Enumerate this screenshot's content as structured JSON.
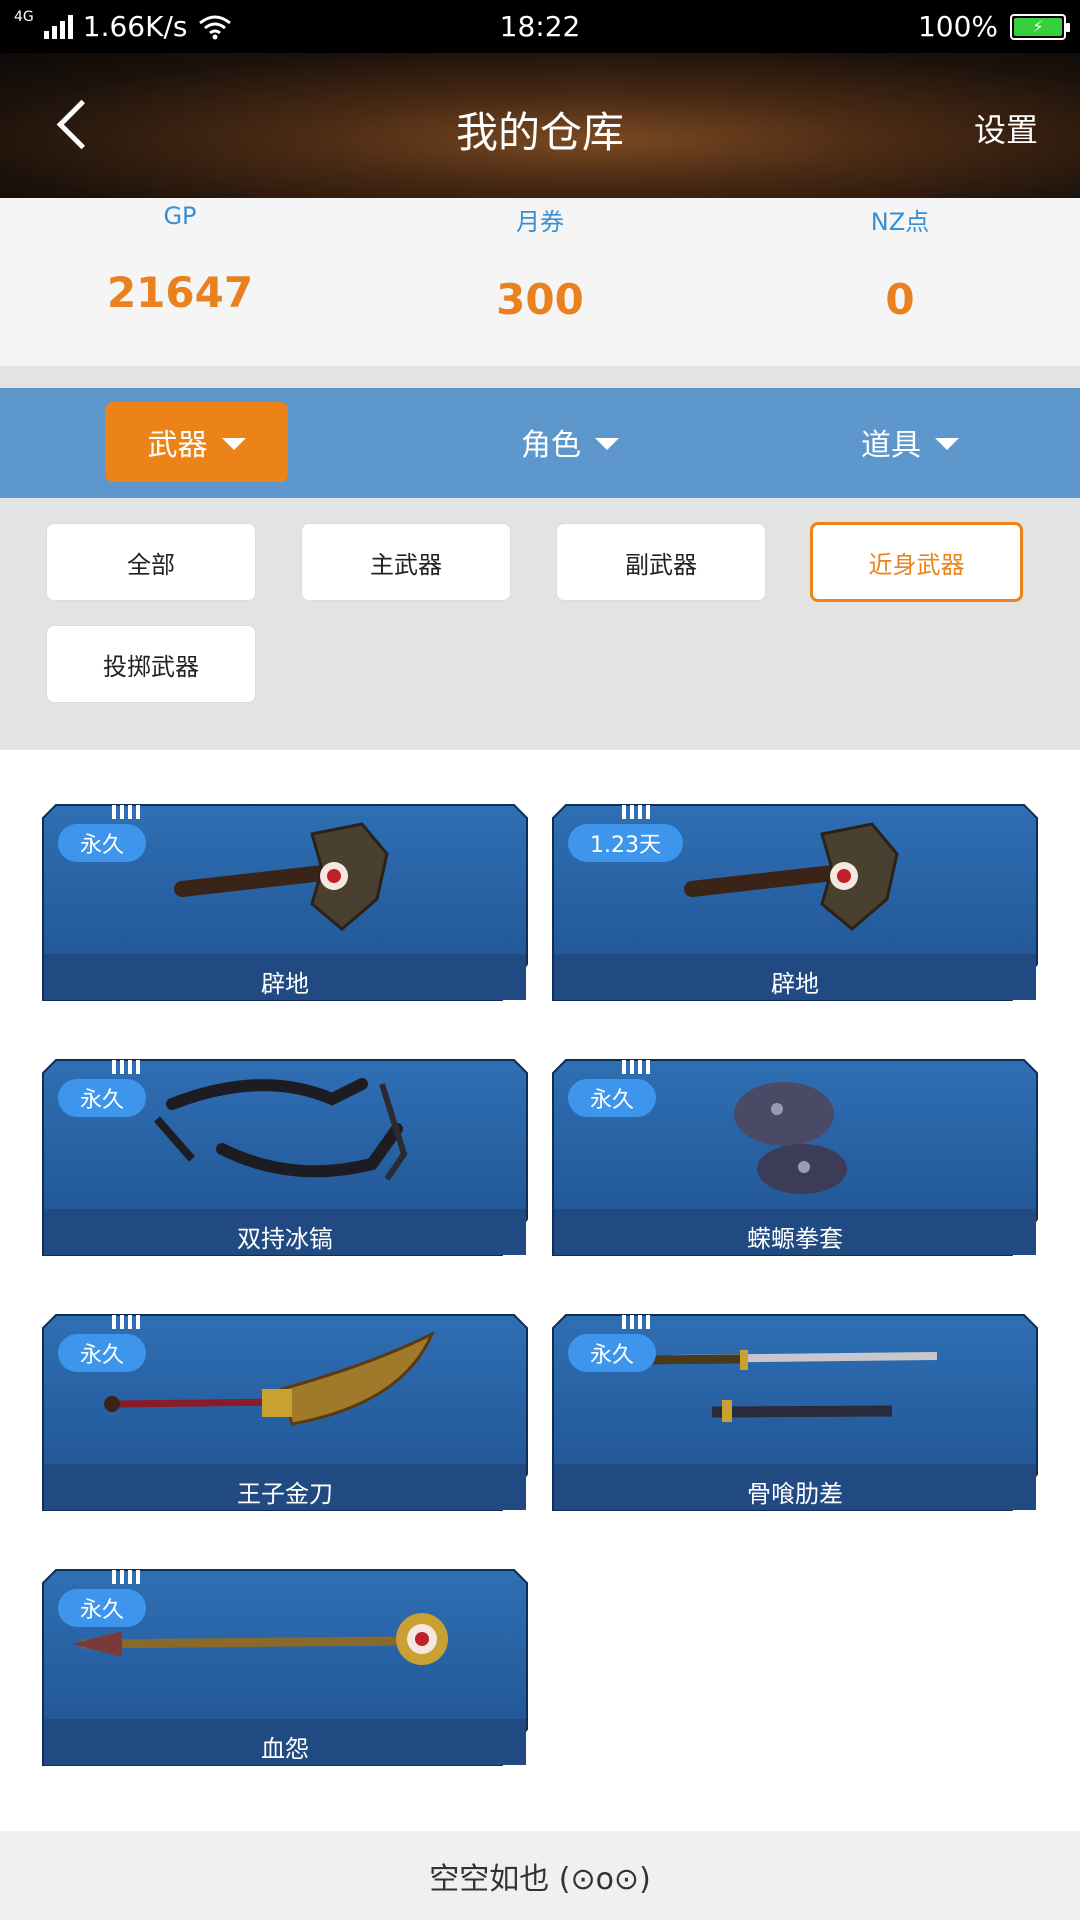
{
  "status_bar": {
    "network": "4G",
    "speed": "1.66K/s",
    "time": "18:22",
    "battery": "100%"
  },
  "header": {
    "title": "我的仓库",
    "settings_label": "设置"
  },
  "currency": [
    {
      "label": "GP",
      "value": "21647"
    },
    {
      "label": "月券",
      "value": "300"
    },
    {
      "label": "NZ点",
      "value": "0"
    }
  ],
  "categories": [
    {
      "label": "武器",
      "active": true
    },
    {
      "label": "角色",
      "active": false
    },
    {
      "label": "道具",
      "active": false
    }
  ],
  "subcategories": [
    {
      "label": "全部",
      "active": false
    },
    {
      "label": "主武器",
      "active": false
    },
    {
      "label": "副武器",
      "active": false
    },
    {
      "label": "近身武器",
      "active": true
    },
    {
      "label": "投掷武器",
      "active": false
    }
  ],
  "items": [
    {
      "badge": "永久",
      "name": "辟地",
      "icon": "axe-icon"
    },
    {
      "badge": "1.23天",
      "name": "辟地",
      "icon": "axe-icon"
    },
    {
      "badge": "永久",
      "name": "双持冰镐",
      "icon": "ice-pick-icon"
    },
    {
      "badge": "永久",
      "name": "蝾螈拳套",
      "icon": "gauntlet-icon"
    },
    {
      "badge": "永久",
      "name": "王子金刀",
      "icon": "glaive-icon"
    },
    {
      "badge": "永久",
      "name": "骨喰肋差",
      "icon": "katana-icon"
    },
    {
      "badge": "永久",
      "name": "血怨",
      "icon": "staff-icon"
    }
  ],
  "footer": {
    "text": "空空如也 (⊙o⊙)"
  },
  "colors": {
    "accent": "#ec8318",
    "blue_bar": "#5e97cc",
    "label_blue": "#3a8fd0"
  }
}
